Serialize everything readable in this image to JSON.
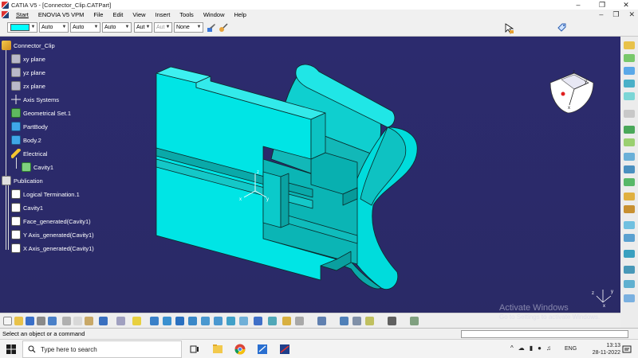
{
  "window": {
    "title": "CATIA V5 - [Connector_Clip.CATPart]"
  },
  "menu": {
    "items": [
      "Start",
      "ENOVIA V5 VPM",
      "File",
      "Edit",
      "View",
      "Insert",
      "Tools",
      "Window",
      "Help"
    ]
  },
  "toolbar": {
    "fill_color": "#00ffff",
    "combos": [
      "Auto",
      "Auto",
      "Auto",
      "Aut",
      "Aut",
      "None"
    ]
  },
  "tree": {
    "root": "Connector_Clip",
    "nodes": [
      {
        "label": "xy plane",
        "icon": "plane-icon"
      },
      {
        "label": "yz plane",
        "icon": "plane-icon"
      },
      {
        "label": "zx plane",
        "icon": "plane-icon"
      },
      {
        "label": "Axis Systems",
        "icon": "axis-system-icon"
      },
      {
        "label": "Geometrical Set.1",
        "icon": "geometrical-set-icon"
      },
      {
        "label": "PartBody",
        "icon": "partbody-icon"
      },
      {
        "label": "Body.2",
        "icon": "body-icon"
      },
      {
        "label": "Electrical",
        "icon": "electrical-icon"
      },
      {
        "label": "Cavity1",
        "icon": "cavity-icon"
      },
      {
        "label": "Publication",
        "icon": "publication-icon"
      },
      {
        "label": "Logical Termination.1",
        "icon": "publication-item-icon"
      },
      {
        "label": "Cavity1",
        "icon": "publication-item-icon"
      },
      {
        "label": "Face_generated(Cavity1)",
        "icon": "publication-item-icon"
      },
      {
        "label": "Y Axis_generated(Cavity1)",
        "icon": "publication-item-icon"
      },
      {
        "label": "X Axis_generated(Cavity1)",
        "icon": "publication-item-icon"
      }
    ]
  },
  "viewport": {
    "background": "#2b2a6b",
    "part_color": "#00e5e5"
  },
  "watermark": {
    "title": "Activate Windows",
    "subtitle": "Go to Settings to activate Windows."
  },
  "status": {
    "message": "Select an object or a command"
  },
  "taskbar": {
    "search_placeholder": "Type here to search",
    "language": "ENG",
    "time": "13:13",
    "date": "28-11-2022"
  }
}
